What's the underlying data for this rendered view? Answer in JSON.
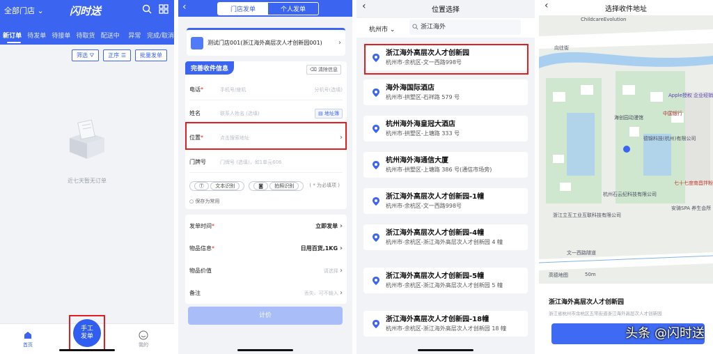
{
  "panel1": {
    "store_selector": "全部门店",
    "brand": "闪时送",
    "tabs": [
      "新订单",
      "待发单",
      "待接单",
      "待取货",
      "配送中",
      "异常",
      "完成/取消"
    ],
    "filters": [
      "筛选",
      "正序",
      "批量发单"
    ],
    "empty_text": "近七天暂无订单",
    "nav": {
      "home": "首页",
      "manual": "手工\n发单",
      "mine": "我的"
    },
    "accent": "#3b64f0"
  },
  "panel2": {
    "segments": [
      "门店发单",
      "个人发单"
    ],
    "store_name": "测试门店001(浙江海外高层次人才创新园001)",
    "form_title": "完善收件信息",
    "clear_label": "清除信息",
    "phone_label": "电话",
    "phone_placeholder": "手机号/座机",
    "ext_placeholder": "分机号(选填)",
    "name_label": "姓名",
    "name_placeholder": "联系人姓名 (选填)",
    "address_book": "地址簿",
    "location_label": "位置",
    "location_placeholder": "点击搜索地址",
    "door_label": "门牌号",
    "door_placeholder": "门牌号 (选填)，如1单元606",
    "text_recog": "文本识别",
    "photo_recog": "拍照识别",
    "required_hint": "( * 为必填项 )",
    "save_common": "保存为常用",
    "send_time_label": "发单时间",
    "send_time_value": "立即发单",
    "goods_label": "物品信息",
    "goods_value": "日用百货,1KG",
    "value_label": "物品价值",
    "value_placeholder": "请选择",
    "remark_label": "备注",
    "remark_placeholder": "丢失、可不输入",
    "submit": "计价"
  },
  "panel3": {
    "title": "位置选择",
    "city": "杭州市",
    "search_value": "浙江海外",
    "results": [
      {
        "name": "浙江海外高层次人才创新园",
        "addr": "杭州市-余杭区-文一西路998号"
      },
      {
        "name": "海外海国际酒店",
        "addr": "杭州市-拱墅区-石祥路 579 号"
      },
      {
        "name": "杭州海外海皇冠大酒店",
        "addr": "杭州市-拱墅区-上塘路 333 号"
      },
      {
        "name": "杭州海外海通信大厦",
        "addr": "杭州市-拱墅区-上塘路 386 号(通信市场旁)"
      },
      {
        "name": "浙江海外高层次人才创新园-1幢",
        "addr": "杭州市-余杭区-文一西路998号"
      },
      {
        "name": "浙江海外高层次人才创新园-4幢",
        "addr": "杭州市-余杭区-浙江海外高层次人才创新园 4 幢"
      },
      {
        "name": "浙江海外高层次人才创新园-5幢",
        "addr": "杭州市-余杭区-浙江海外高层次人才创新园 5 幢"
      },
      {
        "name": "浙江海外高层次人才创新园-18幢",
        "addr": "杭州市-余杭区-浙江海外高层次人才创新园 18 幢"
      }
    ]
  },
  "panel4": {
    "title": "选择收件地址",
    "map_labels": [
      "ChildcareEvolution",
      "向往街",
      "Apple授权 企业经销商",
      "中国银行",
      "海创园动漫馆",
      "德锦科技(杭州)有限公司",
      "杭州石云纪科技有限公司",
      "浙江立互工业互联科技有限公司",
      "安骑SPA 养生会所",
      "七十七度南昌拌粉",
      "文一西路隧道",
      "高德地图",
      "50m"
    ],
    "place_name": "浙江海外高层次人才创新园",
    "place_addr": "浙江省杭州市余杭区五常街道浙江海外高层次人才创新园",
    "watermark": "头条 @闪时送"
  }
}
